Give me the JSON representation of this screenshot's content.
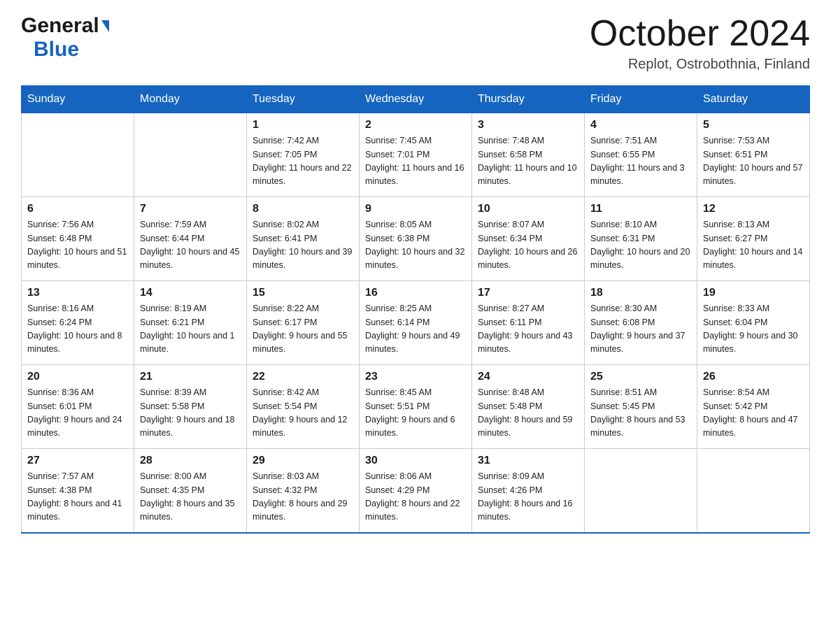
{
  "header": {
    "title": "October 2024",
    "location": "Replot, Ostrobothnia, Finland",
    "logo_general": "General",
    "logo_blue": "Blue"
  },
  "columns": [
    "Sunday",
    "Monday",
    "Tuesday",
    "Wednesday",
    "Thursday",
    "Friday",
    "Saturday"
  ],
  "weeks": [
    [
      {
        "day": "",
        "sunrise": "",
        "sunset": "",
        "daylight": ""
      },
      {
        "day": "",
        "sunrise": "",
        "sunset": "",
        "daylight": ""
      },
      {
        "day": "1",
        "sunrise": "Sunrise: 7:42 AM",
        "sunset": "Sunset: 7:05 PM",
        "daylight": "Daylight: 11 hours and 22 minutes."
      },
      {
        "day": "2",
        "sunrise": "Sunrise: 7:45 AM",
        "sunset": "Sunset: 7:01 PM",
        "daylight": "Daylight: 11 hours and 16 minutes."
      },
      {
        "day": "3",
        "sunrise": "Sunrise: 7:48 AM",
        "sunset": "Sunset: 6:58 PM",
        "daylight": "Daylight: 11 hours and 10 minutes."
      },
      {
        "day": "4",
        "sunrise": "Sunrise: 7:51 AM",
        "sunset": "Sunset: 6:55 PM",
        "daylight": "Daylight: 11 hours and 3 minutes."
      },
      {
        "day": "5",
        "sunrise": "Sunrise: 7:53 AM",
        "sunset": "Sunset: 6:51 PM",
        "daylight": "Daylight: 10 hours and 57 minutes."
      }
    ],
    [
      {
        "day": "6",
        "sunrise": "Sunrise: 7:56 AM",
        "sunset": "Sunset: 6:48 PM",
        "daylight": "Daylight: 10 hours and 51 minutes."
      },
      {
        "day": "7",
        "sunrise": "Sunrise: 7:59 AM",
        "sunset": "Sunset: 6:44 PM",
        "daylight": "Daylight: 10 hours and 45 minutes."
      },
      {
        "day": "8",
        "sunrise": "Sunrise: 8:02 AM",
        "sunset": "Sunset: 6:41 PM",
        "daylight": "Daylight: 10 hours and 39 minutes."
      },
      {
        "day": "9",
        "sunrise": "Sunrise: 8:05 AM",
        "sunset": "Sunset: 6:38 PM",
        "daylight": "Daylight: 10 hours and 32 minutes."
      },
      {
        "day": "10",
        "sunrise": "Sunrise: 8:07 AM",
        "sunset": "Sunset: 6:34 PM",
        "daylight": "Daylight: 10 hours and 26 minutes."
      },
      {
        "day": "11",
        "sunrise": "Sunrise: 8:10 AM",
        "sunset": "Sunset: 6:31 PM",
        "daylight": "Daylight: 10 hours and 20 minutes."
      },
      {
        "day": "12",
        "sunrise": "Sunrise: 8:13 AM",
        "sunset": "Sunset: 6:27 PM",
        "daylight": "Daylight: 10 hours and 14 minutes."
      }
    ],
    [
      {
        "day": "13",
        "sunrise": "Sunrise: 8:16 AM",
        "sunset": "Sunset: 6:24 PM",
        "daylight": "Daylight: 10 hours and 8 minutes."
      },
      {
        "day": "14",
        "sunrise": "Sunrise: 8:19 AM",
        "sunset": "Sunset: 6:21 PM",
        "daylight": "Daylight: 10 hours and 1 minute."
      },
      {
        "day": "15",
        "sunrise": "Sunrise: 8:22 AM",
        "sunset": "Sunset: 6:17 PM",
        "daylight": "Daylight: 9 hours and 55 minutes."
      },
      {
        "day": "16",
        "sunrise": "Sunrise: 8:25 AM",
        "sunset": "Sunset: 6:14 PM",
        "daylight": "Daylight: 9 hours and 49 minutes."
      },
      {
        "day": "17",
        "sunrise": "Sunrise: 8:27 AM",
        "sunset": "Sunset: 6:11 PM",
        "daylight": "Daylight: 9 hours and 43 minutes."
      },
      {
        "day": "18",
        "sunrise": "Sunrise: 8:30 AM",
        "sunset": "Sunset: 6:08 PM",
        "daylight": "Daylight: 9 hours and 37 minutes."
      },
      {
        "day": "19",
        "sunrise": "Sunrise: 8:33 AM",
        "sunset": "Sunset: 6:04 PM",
        "daylight": "Daylight: 9 hours and 30 minutes."
      }
    ],
    [
      {
        "day": "20",
        "sunrise": "Sunrise: 8:36 AM",
        "sunset": "Sunset: 6:01 PM",
        "daylight": "Daylight: 9 hours and 24 minutes."
      },
      {
        "day": "21",
        "sunrise": "Sunrise: 8:39 AM",
        "sunset": "Sunset: 5:58 PM",
        "daylight": "Daylight: 9 hours and 18 minutes."
      },
      {
        "day": "22",
        "sunrise": "Sunrise: 8:42 AM",
        "sunset": "Sunset: 5:54 PM",
        "daylight": "Daylight: 9 hours and 12 minutes."
      },
      {
        "day": "23",
        "sunrise": "Sunrise: 8:45 AM",
        "sunset": "Sunset: 5:51 PM",
        "daylight": "Daylight: 9 hours and 6 minutes."
      },
      {
        "day": "24",
        "sunrise": "Sunrise: 8:48 AM",
        "sunset": "Sunset: 5:48 PM",
        "daylight": "Daylight: 8 hours and 59 minutes."
      },
      {
        "day": "25",
        "sunrise": "Sunrise: 8:51 AM",
        "sunset": "Sunset: 5:45 PM",
        "daylight": "Daylight: 8 hours and 53 minutes."
      },
      {
        "day": "26",
        "sunrise": "Sunrise: 8:54 AM",
        "sunset": "Sunset: 5:42 PM",
        "daylight": "Daylight: 8 hours and 47 minutes."
      }
    ],
    [
      {
        "day": "27",
        "sunrise": "Sunrise: 7:57 AM",
        "sunset": "Sunset: 4:38 PM",
        "daylight": "Daylight: 8 hours and 41 minutes."
      },
      {
        "day": "28",
        "sunrise": "Sunrise: 8:00 AM",
        "sunset": "Sunset: 4:35 PM",
        "daylight": "Daylight: 8 hours and 35 minutes."
      },
      {
        "day": "29",
        "sunrise": "Sunrise: 8:03 AM",
        "sunset": "Sunset: 4:32 PM",
        "daylight": "Daylight: 8 hours and 29 minutes."
      },
      {
        "day": "30",
        "sunrise": "Sunrise: 8:06 AM",
        "sunset": "Sunset: 4:29 PM",
        "daylight": "Daylight: 8 hours and 22 minutes."
      },
      {
        "day": "31",
        "sunrise": "Sunrise: 8:09 AM",
        "sunset": "Sunset: 4:26 PM",
        "daylight": "Daylight: 8 hours and 16 minutes."
      },
      {
        "day": "",
        "sunrise": "",
        "sunset": "",
        "daylight": ""
      },
      {
        "day": "",
        "sunrise": "",
        "sunset": "",
        "daylight": ""
      }
    ]
  ]
}
